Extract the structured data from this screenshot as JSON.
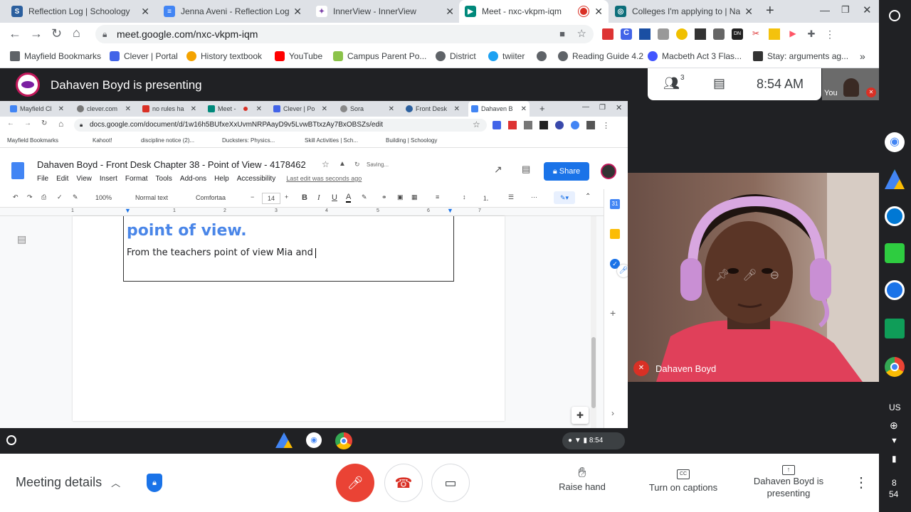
{
  "browser": {
    "tabs": [
      {
        "title": "Reflection Log | Schoology",
        "fav_color": "#2b5f9e",
        "fav_glyph": "S"
      },
      {
        "title": "Jenna Aveni - Reflection Log -",
        "fav_color": "#4285f4",
        "fav_glyph": "≡"
      },
      {
        "title": "InnerView - InnerView",
        "fav_color": "#7b3fa8",
        "fav_glyph": "✦"
      },
      {
        "title": "Meet - nxc-vkpm-iqm",
        "fav_color": "#00897b",
        "fav_glyph": "▶"
      },
      {
        "title": "Colleges I'm applying to | Nav",
        "fav_color": "#0d6e7a",
        "fav_glyph": "◎"
      }
    ],
    "url": "meet.google.com/nxc-vkpm-iqm",
    "bookmarks": [
      {
        "label": "Mayfield Bookmarks",
        "color": "#5f6368"
      },
      {
        "label": "Clever | Portal",
        "color": "#4264e8"
      },
      {
        "label": "History textbook",
        "color": "#f4a300"
      },
      {
        "label": "YouTube",
        "color": "#ff0000"
      },
      {
        "label": "Campus Parent Po...",
        "color": "#8bc34a"
      },
      {
        "label": "District",
        "color": "#5f6368"
      },
      {
        "label": "twiiter",
        "color": "#1da1f2"
      },
      {
        "label": "",
        "color": "#5f6368"
      },
      {
        "label": "Reading Guide 4.2",
        "color": "#5f6368"
      },
      {
        "label": "Macbeth Act 3 Flas...",
        "color": "#4255ff"
      },
      {
        "label": "Stay: arguments ag...",
        "color": "#333333"
      }
    ],
    "more_bookmarks": "»"
  },
  "meet": {
    "presenting_banner": "Dahaven Boyd is presenting",
    "participant_count": "3",
    "time": "8:54 AM",
    "self_label": "You",
    "participant_name": "Dahaven Boyd",
    "meeting_details": "Meeting details",
    "raise_hand": "Raise hand",
    "captions": "Turn on captions",
    "presenting_btn": "Dahaven Boyd is presenting"
  },
  "shared": {
    "tabs": [
      {
        "title": "Mayfield Cl",
        "color": "#4285f4"
      },
      {
        "title": "clever.com",
        "color": "#777"
      },
      {
        "title": "no rules ha",
        "color": "#d93025"
      },
      {
        "title": "Meet -",
        "color": "#00897b"
      },
      {
        "title": "Clever | Po",
        "color": "#4264e8"
      },
      {
        "title": "Sora",
        "color": "#888"
      },
      {
        "title": "Front Desk",
        "color": "#2b5f9e"
      },
      {
        "title": "Dahaven B",
        "color": "#4285f4"
      }
    ],
    "url": "docs.google.com/document/d/1w16h5BUfxeXxUvmNRPAayD9v5LvwBTtxzAy7BxOBSZs/edit",
    "bookmarks": [
      "Mayfield Bookmarks",
      "Kahoot!",
      "discipline notice (2)...",
      "Ducksters: Physics...",
      "Skill Activities | Sch...",
      "Building | Schoology"
    ],
    "doc_title": "Dahaven Boyd - Front Desk Chapter 38 -  Point of View - 4178462",
    "saving": "Saving...",
    "menus": [
      "File",
      "Edit",
      "View",
      "Insert",
      "Format",
      "Tools",
      "Add-ons",
      "Help",
      "Accessibility"
    ],
    "last_edit": "Last edit was seconds ago",
    "share": "Share",
    "zoom": "100%",
    "style": "Normal text",
    "font": "Comfortaa",
    "font_size": "14",
    "heading_text": "point of view.",
    "body_text": "From the teachers point of view Mia and",
    "ruler_marks": [
      "1",
      "1",
      "2",
      "3",
      "4",
      "5",
      "6",
      "7"
    ],
    "clock": "8:54"
  },
  "os": {
    "lang": "US",
    "time_h": "8",
    "time_m": "54"
  }
}
